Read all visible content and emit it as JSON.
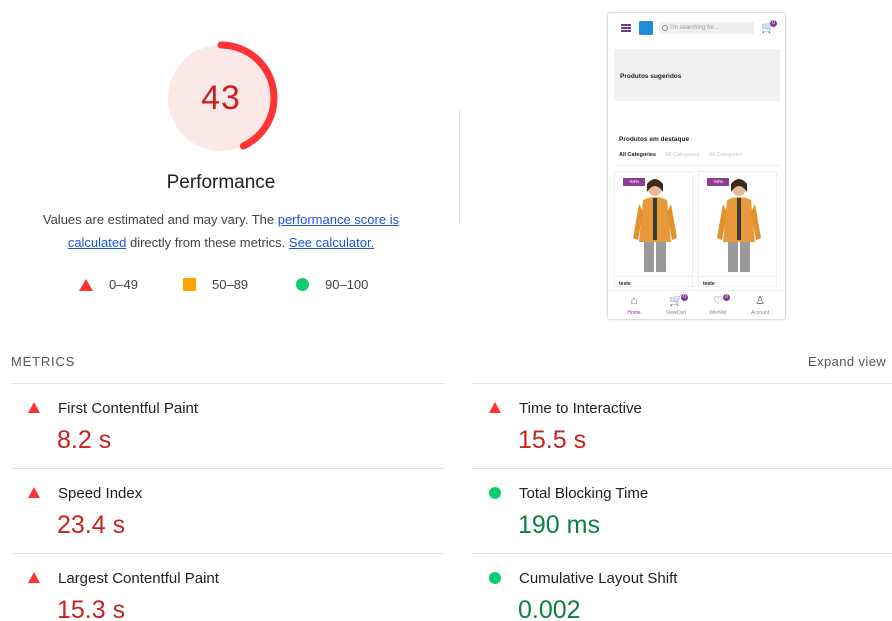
{
  "score": {
    "value": "43",
    "fraction": 0.43,
    "ring_color": "#ff3333",
    "bg_color": "#fde8e8",
    "text_color": "#c7221f"
  },
  "category_title": "Performance",
  "description": {
    "text1": "Values are estimated and may vary. The ",
    "link1": "performance score is calculated",
    "text2": " directly from these metrics. ",
    "link2": "See calculator."
  },
  "legend": [
    {
      "shape": "triangle-icon",
      "range": "0–49",
      "color": "#ff3333"
    },
    {
      "shape": "square-icon",
      "range": "50–89",
      "color": "#ffa400"
    },
    {
      "shape": "circle-icon",
      "range": "90–100",
      "color": "#0cce6b"
    }
  ],
  "preview": {
    "search_placeholder": "I'm searching for...",
    "cart_count": "0",
    "banner_title": "Produtos sugeridos",
    "section_title": "Produtos em destaque",
    "categories": [
      "All Categories",
      "All Categories",
      "All Categories"
    ],
    "products": [
      {
        "discount": "-53%",
        "name": "teste"
      },
      {
        "discount": "-50%",
        "name": "teste"
      }
    ],
    "nav": [
      {
        "label": "Home",
        "icon": "home-icon"
      },
      {
        "label": "ViewCart",
        "icon": "cart-icon",
        "badge": "0"
      },
      {
        "label": "Wishlist",
        "icon": "heart-icon",
        "badge": "0"
      },
      {
        "label": "Account",
        "icon": "user-icon"
      }
    ],
    "accent_color": "#8e3f93"
  },
  "metrics_title": "METRICS",
  "expand_label": "Expand view",
  "metrics": [
    {
      "label": "First Contentful Paint",
      "value": "8.2 s",
      "status": "fail"
    },
    {
      "label": "Time to Interactive",
      "value": "15.5 s",
      "status": "fail"
    },
    {
      "label": "Speed Index",
      "value": "23.4 s",
      "status": "fail"
    },
    {
      "label": "Total Blocking Time",
      "value": "190 ms",
      "status": "pass"
    },
    {
      "label": "Largest Contentful Paint",
      "value": "15.3 s",
      "status": "fail"
    },
    {
      "label": "Cumulative Layout Shift",
      "value": "0.002",
      "status": "pass"
    }
  ]
}
